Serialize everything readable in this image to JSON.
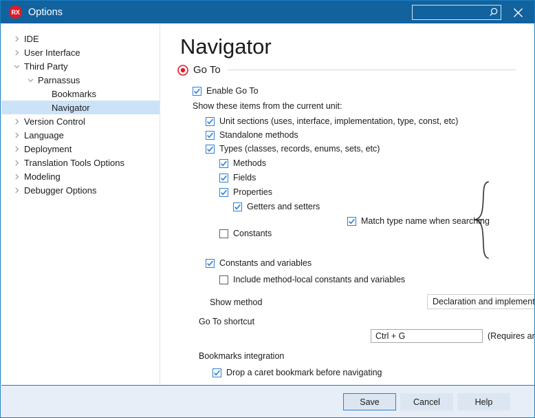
{
  "titlebar": {
    "logo_text": "RX",
    "title": "Options",
    "search_value": "",
    "search_placeholder": "",
    "search_icon": "search-icon",
    "close_icon": "close-icon"
  },
  "sidebar": {
    "items": [
      {
        "label": "IDE",
        "indent": 0,
        "chevron": "right",
        "selected": false
      },
      {
        "label": "User Interface",
        "indent": 0,
        "chevron": "right",
        "selected": false
      },
      {
        "label": "Third Party",
        "indent": 0,
        "chevron": "down",
        "selected": false
      },
      {
        "label": "Parnassus",
        "indent": 1,
        "chevron": "down",
        "selected": false
      },
      {
        "label": "Bookmarks",
        "indent": 2,
        "chevron": "none",
        "selected": false
      },
      {
        "label": "Navigator",
        "indent": 2,
        "chevron": "none",
        "selected": true
      },
      {
        "label": "Version Control",
        "indent": 0,
        "chevron": "right",
        "selected": false
      },
      {
        "label": "Language",
        "indent": 0,
        "chevron": "right",
        "selected": false
      },
      {
        "label": "Deployment",
        "indent": 0,
        "chevron": "right",
        "selected": false
      },
      {
        "label": "Translation Tools Options",
        "indent": 0,
        "chevron": "right",
        "selected": false
      },
      {
        "label": "Modeling",
        "indent": 0,
        "chevron": "right",
        "selected": false
      },
      {
        "label": "Debugger Options",
        "indent": 0,
        "chevron": "right",
        "selected": false
      }
    ]
  },
  "main": {
    "page_title": "Navigator",
    "section": {
      "icon": "bullseye-icon",
      "title": "Go To"
    },
    "enable_go_to": {
      "label": "Enable Go To",
      "checked": true
    },
    "show_items_label": "Show these items from the current unit:",
    "items": [
      {
        "label": "Unit sections (uses, interface, implementation, type, const, etc)",
        "checked": true
      },
      {
        "label": "Standalone methods",
        "checked": true
      },
      {
        "label": "Types (classes, records, enums, sets, etc)",
        "checked": true
      },
      {
        "label": "Methods",
        "checked": true
      },
      {
        "label": "Fields",
        "checked": true
      },
      {
        "label": "Properties",
        "checked": true
      },
      {
        "label": "Getters and setters",
        "checked": true
      },
      {
        "label": "Constants",
        "checked": false
      },
      {
        "label": "Constants and variables",
        "checked": true
      },
      {
        "label": "Include method-local constants and variables",
        "checked": false
      }
    ],
    "match_type_name": {
      "label": "Match type name when searching",
      "checked": true
    },
    "show_method": {
      "label": "Show method",
      "value": "Declaration and implementation",
      "chevron_icon": "chevron-down-icon"
    },
    "go_to_shortcut": {
      "label": "Go To shortcut",
      "value": "Ctrl + G",
      "hint": "(Requires an IDE restart to take effect.)"
    },
    "bookmarks_integration": {
      "label": "Bookmarks integration",
      "checkbox": {
        "label": "Drop a caret bookmark before navigating",
        "checked": true
      }
    }
  },
  "scrollbar": {
    "up_icon": "chevron-up-icon",
    "down_icon": "chevron-down-icon"
  },
  "footer": {
    "save": "Save",
    "cancel": "Cancel",
    "help": "Help"
  },
  "colors": {
    "titlebar": "#12629e",
    "accent": "#2d7fd3",
    "selection": "#cce3f7",
    "logo": "#e01b24",
    "footer": "#e7eef7"
  }
}
